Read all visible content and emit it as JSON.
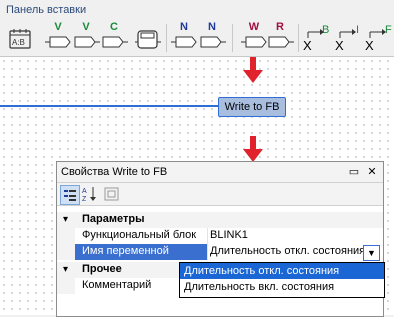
{
  "panel": {
    "title": "Панель вставки"
  },
  "toolbar": {
    "items": [
      {
        "id": "calendar",
        "label": ""
      },
      {
        "id": "v-in",
        "label": "V",
        "color": "#1a8a3a"
      },
      {
        "id": "v-out",
        "label": "V",
        "color": "#1a8a3a"
      },
      {
        "id": "c",
        "label": "C",
        "color": "#1a8a3a"
      },
      {
        "id": "block",
        "label": ""
      },
      {
        "id": "n-in",
        "label": "N",
        "color": "#1f3a9a"
      },
      {
        "id": "n-out",
        "label": "N",
        "color": "#1f3a9a"
      },
      {
        "id": "w",
        "label": "W",
        "color": "#a01040"
      },
      {
        "id": "r",
        "label": "R",
        "color": "#a01040"
      },
      {
        "id": "xb",
        "label_x": "X",
        "label_sub": "B"
      },
      {
        "id": "xi",
        "label_x": "X",
        "label_sub": "I"
      },
      {
        "id": "xf",
        "label_x": "X",
        "label_sub": "F"
      }
    ]
  },
  "canvas": {
    "block_label": "Write to FB"
  },
  "properties": {
    "title": "Свойства Write to FB",
    "title_buttons": {
      "restore": "▭",
      "close": "✕"
    },
    "sort_icon_label": "AZ",
    "categories": [
      {
        "name": "Параметры",
        "rows": [
          {
            "name": "Функциональный блок",
            "value": "BLINK1"
          },
          {
            "name": "Имя переменной",
            "value": "Длительность откл. состояния"
          }
        ]
      },
      {
        "name": "Прочее",
        "rows": [
          {
            "name": "Комментарий",
            "value": ""
          }
        ]
      }
    ]
  },
  "dropdown": {
    "options": [
      "Длительность откл. состояния",
      "Длительность вкл. состояния"
    ],
    "selected_index": 0
  }
}
